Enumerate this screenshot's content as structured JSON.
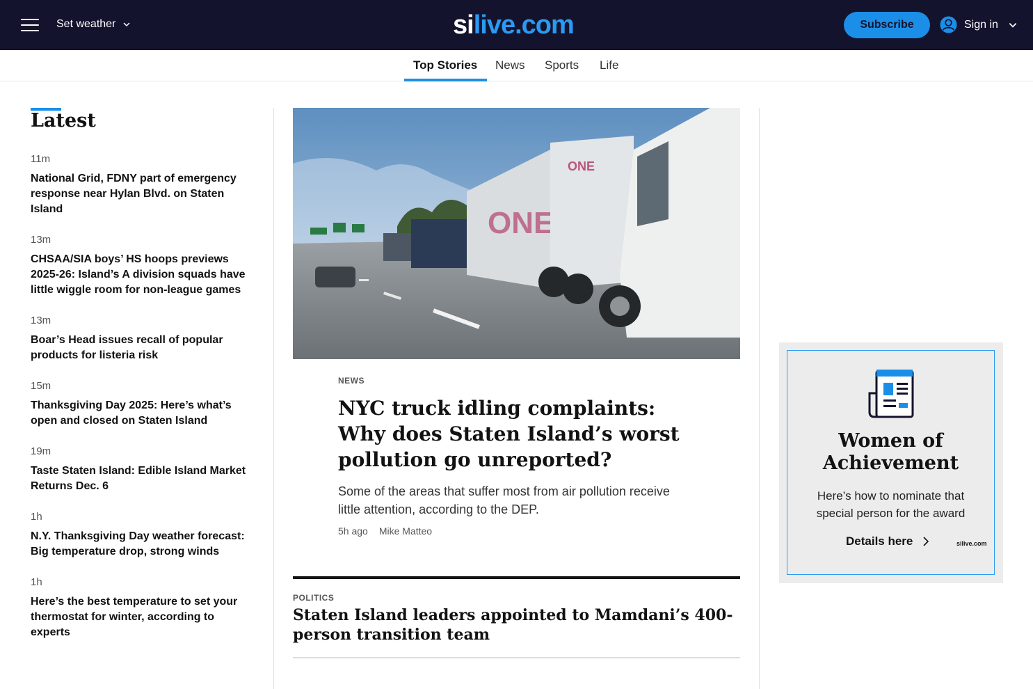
{
  "header": {
    "weather_label": "Set weather",
    "logo_prefix": "si",
    "logo_suffix": "live.com",
    "subscribe_label": "Subscribe",
    "signin_label": "Sign in"
  },
  "nav": {
    "tabs": [
      {
        "label": "Top Stories",
        "active": true
      },
      {
        "label": "News"
      },
      {
        "label": "Sports"
      },
      {
        "label": "Life"
      }
    ]
  },
  "latest": {
    "title": "Latest",
    "items": [
      {
        "time": "11m",
        "headline": "National Grid, FDNY part of emergency response near Hylan Blvd. on Staten Island"
      },
      {
        "time": "13m",
        "headline": "CHSAA/SIA boys’ HS hoops previews 2025-26: Island’s A division squads have little wiggle room for non-league games"
      },
      {
        "time": "13m",
        "headline": "Boar’s Head issues recall of popular products for listeria risk"
      },
      {
        "time": "15m",
        "headline": "Thanksgiving Day 2025: Here’s what’s open and closed on Staten Island"
      },
      {
        "time": "19m",
        "headline": "Taste Staten Island: Edible Island Market Returns Dec. 6"
      },
      {
        "time": "1h",
        "headline": "N.Y. Thanksgiving Day weather forecast: Big temperature drop, strong winds"
      },
      {
        "time": "1h",
        "headline": "Here’s the best temperature to set your thermostat for winter, according to experts"
      }
    ]
  },
  "main_story": {
    "kicker": "NEWS",
    "headline": "NYC truck idling complaints: Why does Staten Island’s worst pollution go unreported?",
    "dek": "Some of the areas that suffer most from air pollution receive little attention, according to the DEP.",
    "time": "5h ago",
    "author": "Mike Matteo"
  },
  "second_story": {
    "kicker": "POLITICS",
    "headline": "Staten Island leaders appointed to Mamdani’s 400-person transition team"
  },
  "promo": {
    "title": "Women of Achievement",
    "text": "Here’s how to nominate that special person for the award",
    "link": "Details here",
    "brand": "silive.com"
  },
  "colors": {
    "header_bg": "#13132d",
    "accent": "#1b8fe8"
  }
}
